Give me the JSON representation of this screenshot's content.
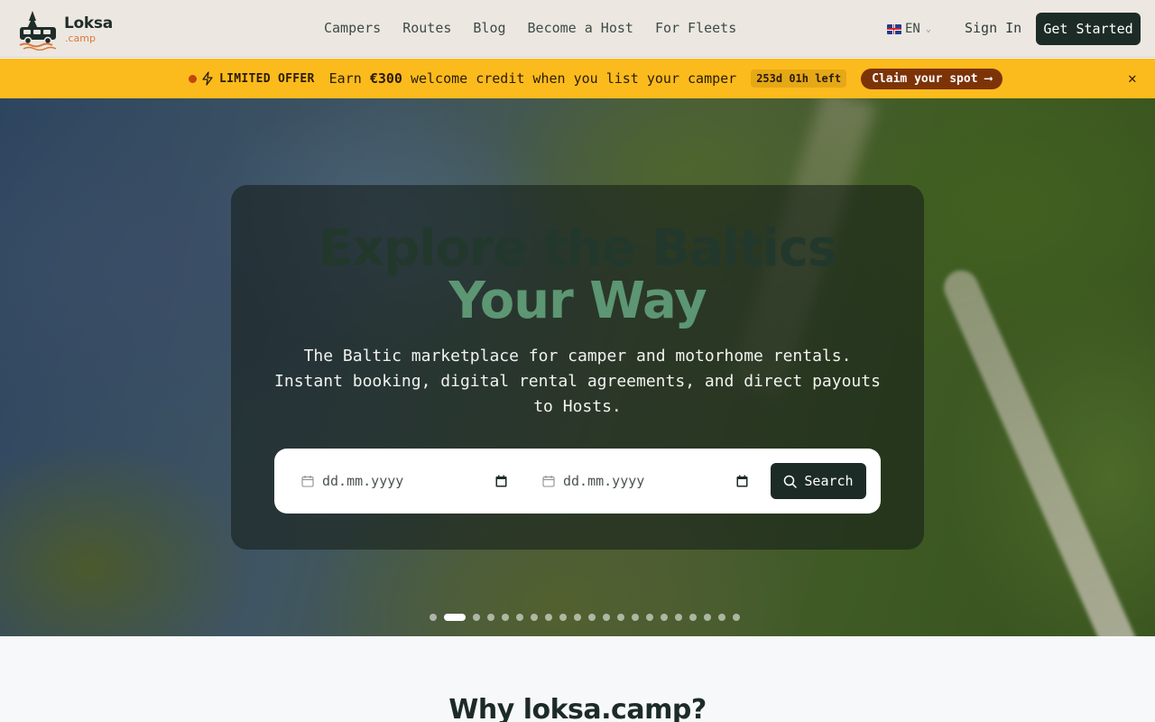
{
  "brand": {
    "name": "Loksa",
    "sub": ".camp"
  },
  "nav": [
    {
      "label": "Campers"
    },
    {
      "label": "Routes"
    },
    {
      "label": "Blog"
    },
    {
      "label": "Become a Host"
    },
    {
      "label": "For Fleets"
    }
  ],
  "language": {
    "code": "EN",
    "flag": "uk-flag"
  },
  "header": {
    "sign_in": "Sign In",
    "get_started": "Get Started"
  },
  "offer": {
    "tag": "LIMITED OFFER",
    "text_pre": "Earn ",
    "amount": "€300",
    "text_post": " welcome credit when you list your camper",
    "countdown": "253d 01h left",
    "cta": "Claim your spot ⟶",
    "close": "✕"
  },
  "hero": {
    "title_line1": "Explore the Baltics",
    "title_line2": "Your Way",
    "subtitle": "The Baltic marketplace for camper and motorhome rentals. Instant booking, digital rental agreements, and direct payouts to Hosts.",
    "start_date_placeholder": "dd.mm.yyyy",
    "end_date_placeholder": "dd.mm.yyyy",
    "search_label": "Search",
    "slides_total": 21,
    "active_slide": 2
  },
  "section": {
    "why_title": "Why loksa.camp?"
  },
  "colors": {
    "brand_dark": "#1d2b27",
    "accent_green": "#5c9673",
    "offer_yellow": "#fcbb1c",
    "offer_cta": "#7d3308",
    "logo_orange": "#d9793a"
  }
}
